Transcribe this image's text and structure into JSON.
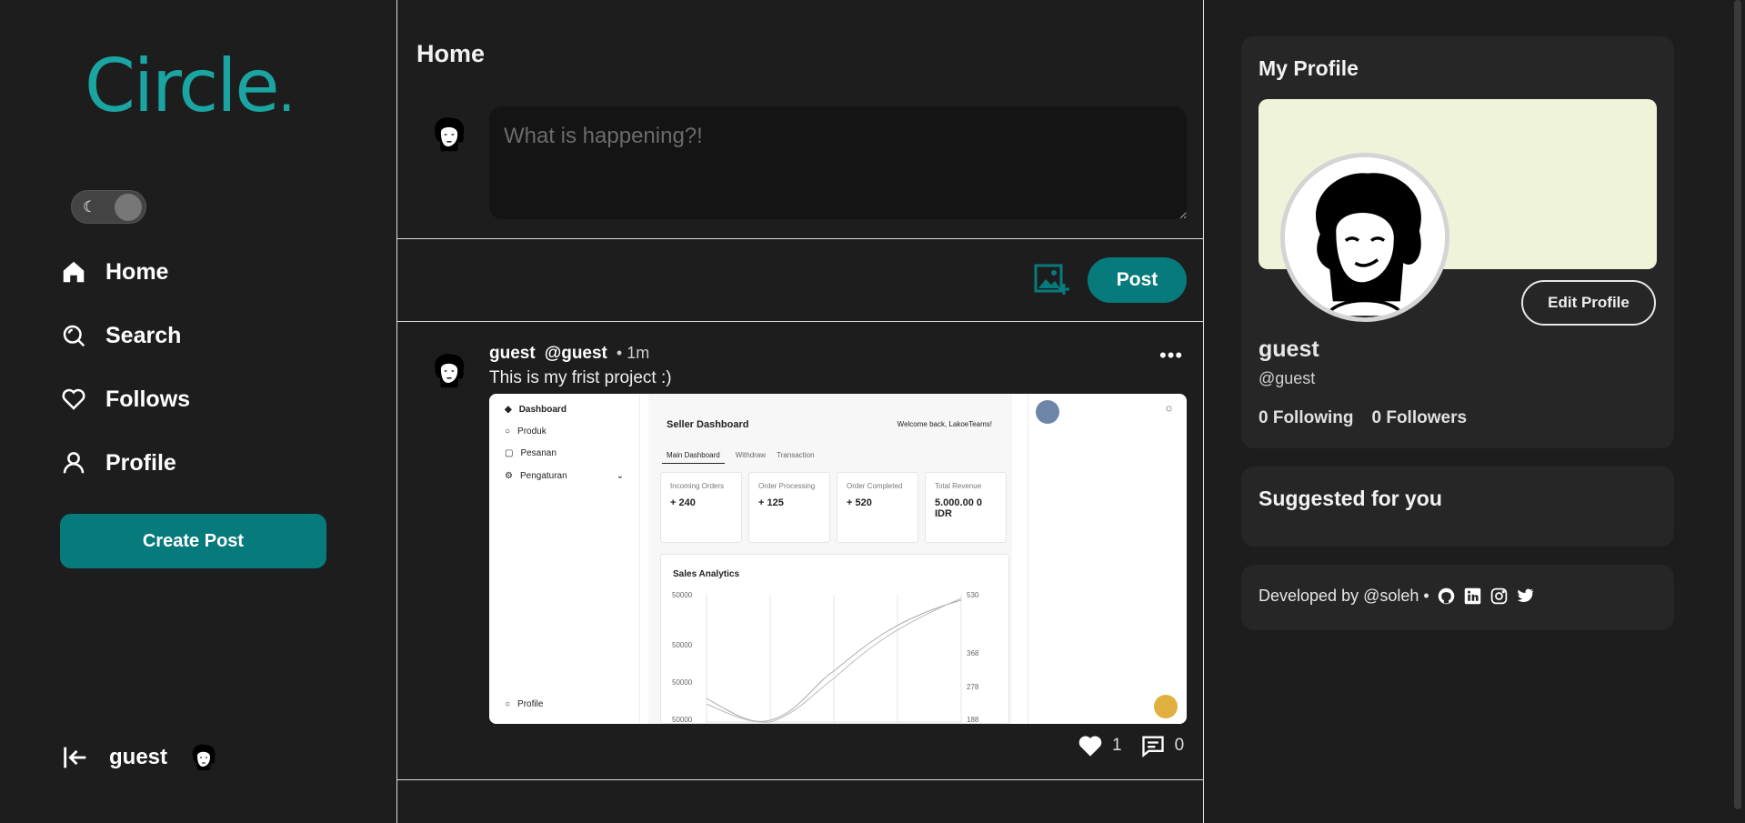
{
  "app": {
    "logo": "Circle",
    "logo_dot": "."
  },
  "sidebar": {
    "items": [
      {
        "label": "Home",
        "icon": "home-icon"
      },
      {
        "label": "Search",
        "icon": "search-icon"
      },
      {
        "label": "Follows",
        "icon": "heart-icon"
      },
      {
        "label": "Profile",
        "icon": "user-icon"
      }
    ],
    "create_label": "Create Post",
    "user": "guest"
  },
  "main": {
    "title": "Home",
    "composer": {
      "placeholder": "What is happening?!",
      "post_label": "Post"
    },
    "post": {
      "name": "guest",
      "handle": "@guest",
      "time": "• 1m",
      "text": "This is my frist project :)",
      "likes": "1",
      "comments": "0",
      "image": {
        "side": [
          "Dashboard",
          "Produk",
          "Pesanan",
          "Pengaturan"
        ],
        "profile": "Profile",
        "title": "Seller Dashboard",
        "welcome": "Welcome back, LakoeTeams!",
        "tabs": [
          "Main Dashboard",
          "Withdraw",
          "Transaction"
        ],
        "cards": [
          {
            "label": "Incoming Orders",
            "value": "+ 240"
          },
          {
            "label": "Order Processing",
            "value": "+ 125"
          },
          {
            "label": "Order Completed",
            "value": "+ 520"
          },
          {
            "label": "Total Revenue",
            "value": "5.000.00 0 IDR"
          }
        ],
        "chart_title": "Sales Analytics",
        "y_ticks": [
          "50000",
          "50000",
          "50000",
          "50000"
        ],
        "r_ticks": [
          "530",
          "368",
          "278",
          "188"
        ]
      }
    }
  },
  "profile": {
    "title": "My Profile",
    "edit_label": "Edit Profile",
    "name": "guest",
    "handle": "@guest",
    "following": "0 Following",
    "followers": "0 Followers"
  },
  "suggested": {
    "title": "Suggested for you"
  },
  "footer": {
    "text": "Developed by @soleh •"
  },
  "colors": {
    "accent": "#077a7c",
    "logo": "#1aa5a3",
    "background": "#1d1d1d",
    "card": "#262626",
    "banner": "#eff3d9"
  }
}
